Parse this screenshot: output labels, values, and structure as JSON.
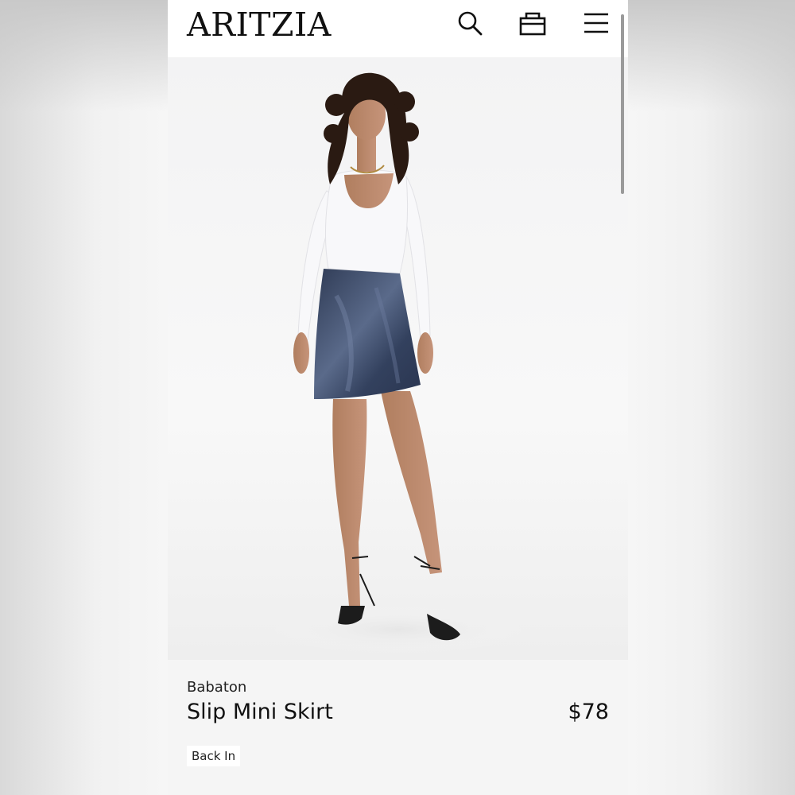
{
  "header": {
    "logo": "ARITZIA",
    "icons": [
      "search-icon",
      "bag-icon",
      "menu-icon"
    ]
  },
  "product": {
    "image": "product-photo",
    "brand": "Babaton",
    "name": "Slip Mini Skirt",
    "price": "$78",
    "badge": "Back In"
  },
  "colors": {
    "page_bg": "#f5f5f5",
    "header_bg": "#ffffff",
    "text": "#111111",
    "skirt": "#3c4a66",
    "top": "#ffffff"
  }
}
